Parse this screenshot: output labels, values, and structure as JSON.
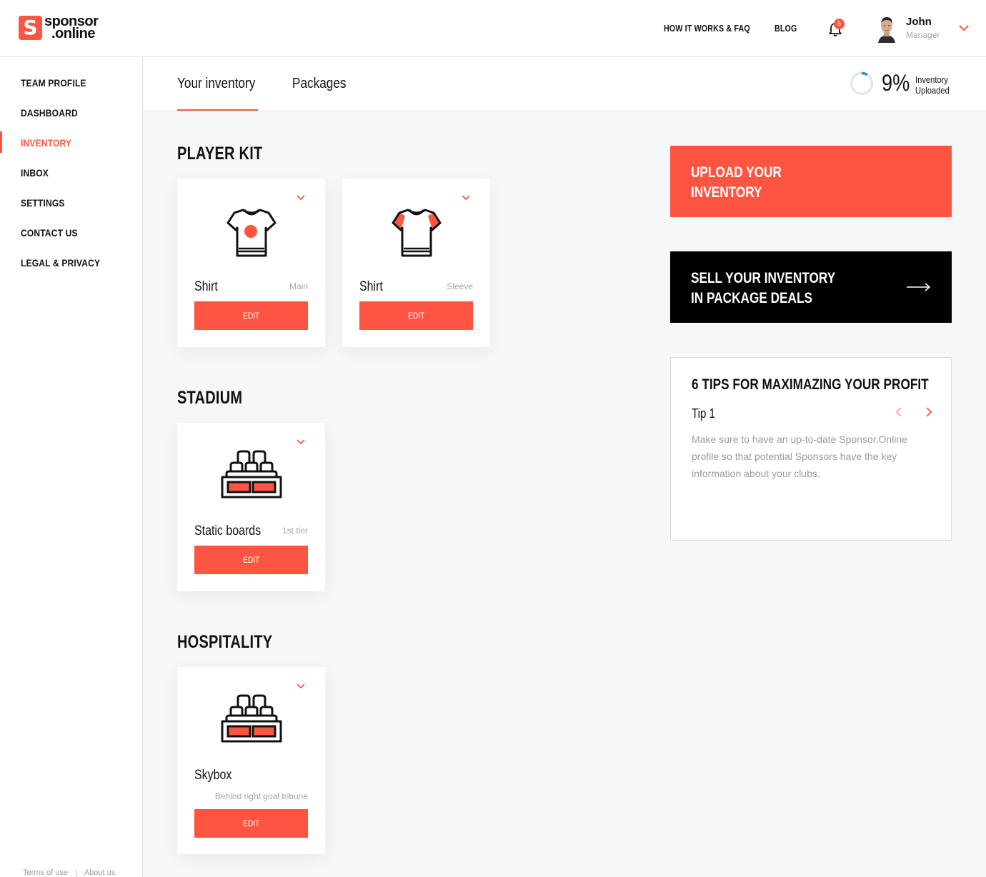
{
  "brand": {
    "line1": "sponsor",
    "line2": ".online",
    "mark": "S",
    "accent": "#fd5541"
  },
  "topnav": {
    "faq": "HOW IT WORKS & FAQ",
    "blog": "BLOG",
    "notifications": "5"
  },
  "user": {
    "name": "John",
    "role": "Manager"
  },
  "sidebar": {
    "items": [
      {
        "label": "TEAM PROFILE"
      },
      {
        "label": "DASHBOARD"
      },
      {
        "label": "INVENTORY"
      },
      {
        "label": "INBOX"
      },
      {
        "label": "SETTINGS"
      },
      {
        "label": "CONTACT US"
      },
      {
        "label": "LEGAL & PRIVACY"
      }
    ],
    "active": "INVENTORY",
    "footer": {
      "terms": "Terms of use",
      "separator": "|",
      "about": "About us"
    }
  },
  "tabs": {
    "inventory": "Your inventory",
    "packages": "Packages"
  },
  "progress": {
    "percent": "9%",
    "value": 0.09,
    "line1": "Inventory",
    "line2": "Uploaded"
  },
  "sections": {
    "player_kit": {
      "title": "PLAYER KIT",
      "cards": [
        {
          "name": "Shirt",
          "sub": "Main",
          "edit": "EDIT",
          "icon": "shirt-main-icon"
        },
        {
          "name": "Shirt",
          "sub": "Sleeve",
          "edit": "EDIT",
          "icon": "shirt-sleeve-icon"
        }
      ]
    },
    "stadium": {
      "title": "STADIUM",
      "cards": [
        {
          "name": "Static boards",
          "sub": "1st tier",
          "edit": "EDIT",
          "icon": "stadium-seats-icon"
        }
      ]
    },
    "hospitality": {
      "title": "HOSPITALITY",
      "cards": [
        {
          "name": "Skybox",
          "sub": "Behind right goal tribune",
          "edit": "EDIT",
          "icon": "stadium-seats-icon"
        }
      ]
    }
  },
  "cta": {
    "upload": {
      "line1": "UPLOAD YOUR",
      "line2": "INVENTORY"
    },
    "sell": {
      "line1": "SELL YOUR INVENTORY",
      "line2": "IN PACKAGE DEALS"
    }
  },
  "tips": {
    "title": "6 TIPS FOR MAXIMAZING YOUR PROFIT",
    "current_label": "Tip 1",
    "text": "Make sure to have an up-to-date Sponsor.Online profile so that potential Sponsors have the key information about your clubs."
  }
}
